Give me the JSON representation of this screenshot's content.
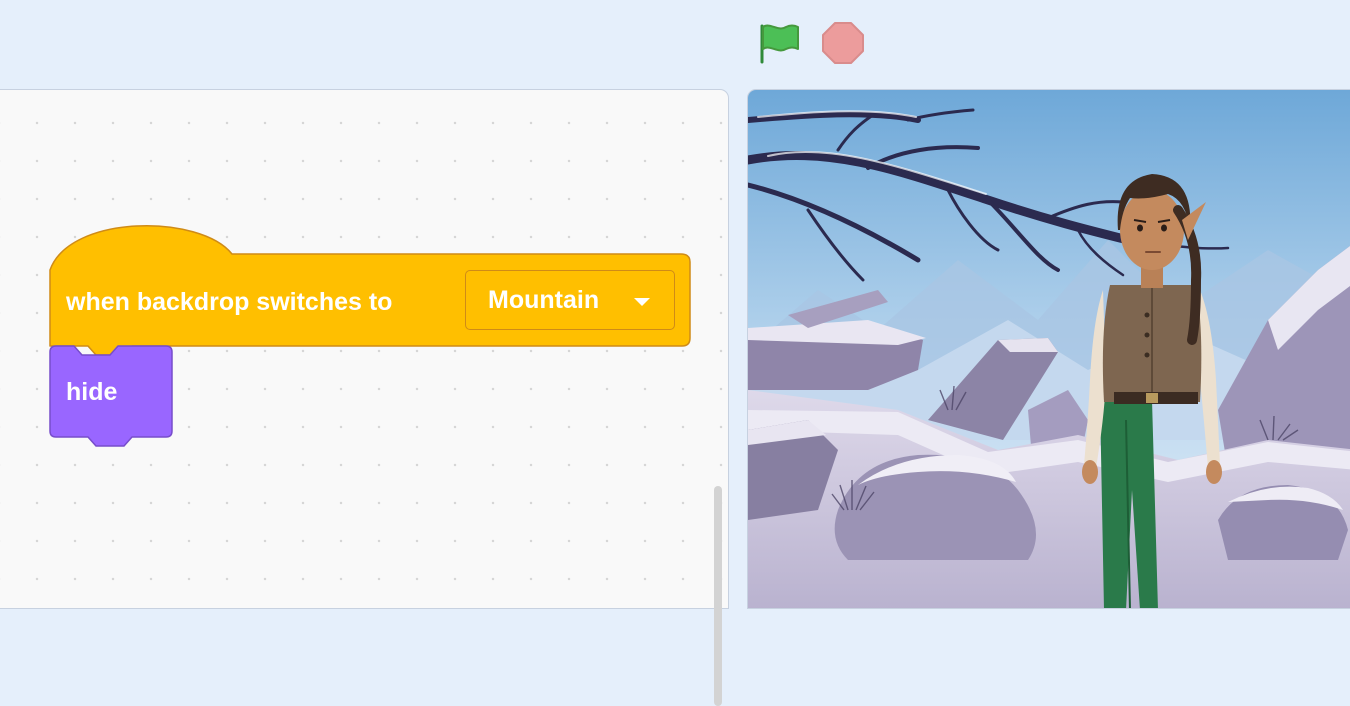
{
  "toolbar": {
    "green_flag_icon": "green-flag-icon",
    "stop_icon": "stop-sign-icon",
    "flag_color": "#4cbf56",
    "stop_color": "#ec9c9c"
  },
  "code_area": {
    "hat_block": {
      "label": "when backdrop switches to",
      "dropdown_value": "Mountain",
      "color": "#ffbf00",
      "border_color": "#cf8b17"
    },
    "stack_block": {
      "label": "hide",
      "color": "#9966ff",
      "border_color": "#774dcb"
    }
  },
  "stage": {
    "backdrop": "Mountain",
    "sprite": "elf-girl-sprite"
  }
}
